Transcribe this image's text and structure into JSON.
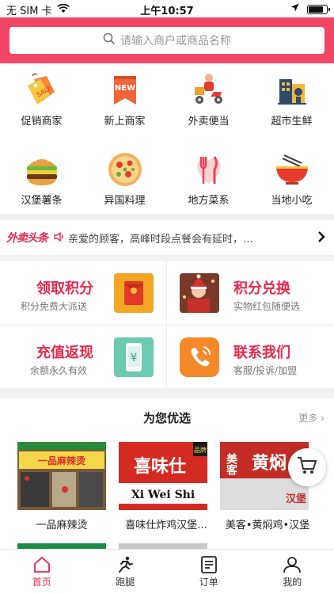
{
  "status_bar": {
    "carrier": "无 SIM 卡",
    "time": "上午10:57",
    "battery_level": 0.9
  },
  "search": {
    "placeholder": "请输入商户或商品名称"
  },
  "categories": [
    {
      "label": "促销商家",
      "icon": "sale-tags-icon"
    },
    {
      "label": "新上商家",
      "icon": "new-badge-icon"
    },
    {
      "label": "外卖便当",
      "icon": "delivery-scooter-icon"
    },
    {
      "label": "超市生鲜",
      "icon": "supermarket-icon"
    },
    {
      "label": "汉堡薯条",
      "icon": "burger-icon"
    },
    {
      "label": "异国料理",
      "icon": "pizza-icon"
    },
    {
      "label": "地方菜系",
      "icon": "fork-knife-icon"
    },
    {
      "label": "当地小吃",
      "icon": "noodle-bowl-icon"
    }
  ],
  "ticker": {
    "brand": "外卖头条",
    "message": "亲爱的顾客，高峰时段点餐会有延时，…"
  },
  "promos": [
    {
      "title": "领取积分",
      "subtitle": "积分免费大派送",
      "icon": "red-envelope-icon"
    },
    {
      "title": "积分兑换",
      "subtitle": "实物红包随便选",
      "icon": "gift-photo-icon"
    },
    {
      "title": "充值返现",
      "subtitle": "余额永久有效",
      "icon": "yuan-phone-icon"
    },
    {
      "title": "联系我们",
      "subtitle": "客服/投诉/加盟",
      "icon": "phone-call-icon"
    }
  ],
  "recommend": {
    "title": "为您优选",
    "more": "更多",
    "shops": [
      {
        "name": "一品麻辣烫",
        "sign": "一品麻辣烫"
      },
      {
        "name": "喜味仕炸鸡汉堡...",
        "sign": "喜味仕",
        "sign_en": "Xi Wei Shi",
        "tag": "品牌"
      },
      {
        "name": "美客•黄焖鸡•汉堡",
        "sign": "黄焖",
        "sign_side": "美客",
        "sign_extra": "汉堡"
      }
    ]
  },
  "tabs": [
    {
      "label": "首页",
      "icon": "home-icon"
    },
    {
      "label": "跑腿",
      "icon": "runner-icon"
    },
    {
      "label": "订单",
      "icon": "order-list-icon"
    },
    {
      "label": "我的",
      "icon": "user-icon"
    }
  ],
  "colors": {
    "brand": "#f24667",
    "accent": "#e8284c"
  }
}
